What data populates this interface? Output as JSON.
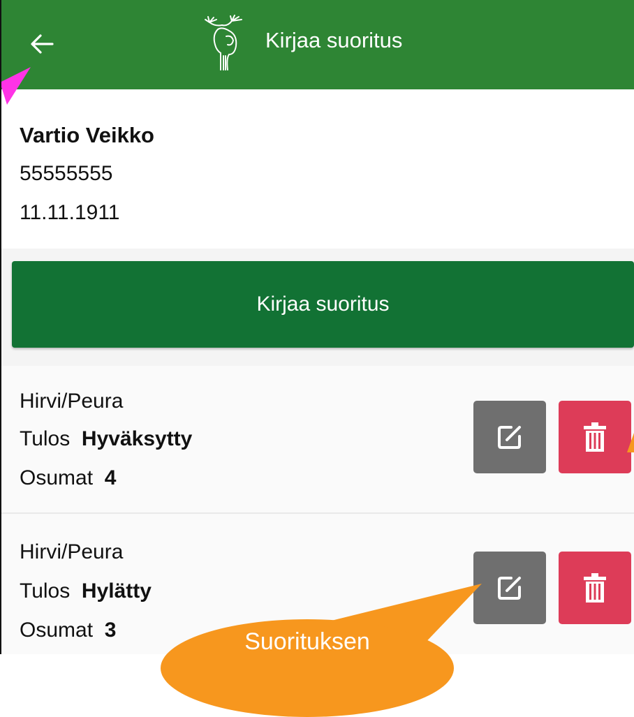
{
  "appbar": {
    "title": "Kirjaa suoritus"
  },
  "person": {
    "name": "Vartio Veikko",
    "id": "55555555",
    "birth_date": "11.11.1911"
  },
  "primary_button": {
    "label": "Kirjaa suoritus"
  },
  "records": [
    {
      "type": "Hirvi/Peura",
      "result_label": "Tulos",
      "result_value": "Hyväksytty",
      "hits_label": "Osumat",
      "hits_value": "4"
    },
    {
      "type": "Hirvi/Peura",
      "result_label": "Tulos",
      "result_value": "Hylätty",
      "hits_label": "Osumat",
      "hits_value": "3"
    }
  ],
  "callout": {
    "text": "Suorituksen"
  },
  "colors": {
    "appbar": "#2e8534",
    "primary_button": "#127234",
    "edit_button": "#6f6f6f",
    "delete_button": "#dd3c58",
    "callout_orange": "#f7971e",
    "callout_magenta": "#ff33e6"
  }
}
